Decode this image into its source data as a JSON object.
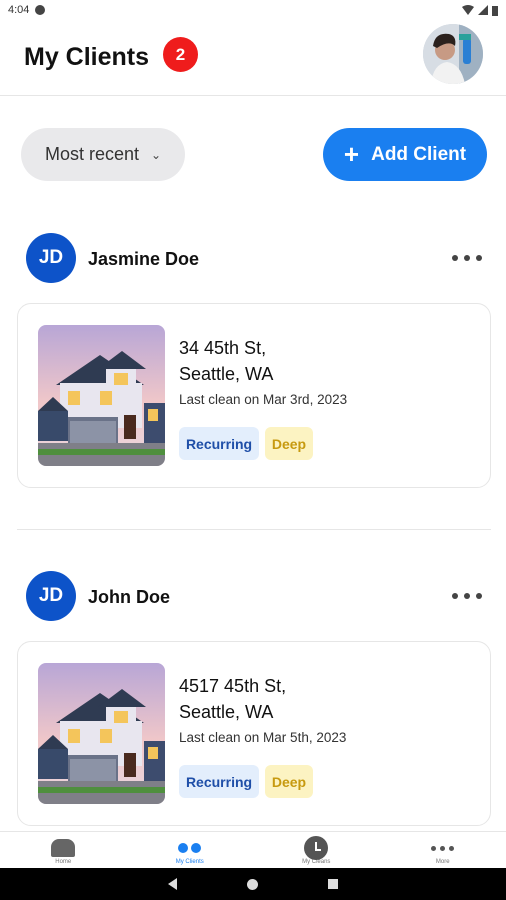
{
  "status_bar": {
    "time": "4:04"
  },
  "header": {
    "title": "My Clients",
    "badge_count": "2"
  },
  "toolbar": {
    "sort_label": "Most recent",
    "add_client_label": "Add Client"
  },
  "clients": [
    {
      "initials": "JD",
      "name": "Jasmine Doe",
      "address_line1": "34 45th St,",
      "address_line2": "Seattle, WA",
      "last_clean": "Last clean on Mar 3rd, 2023",
      "tags": [
        "Recurring",
        "Deep"
      ]
    },
    {
      "initials": "JD",
      "name": "John Doe",
      "address_line1": "4517 45th St,",
      "address_line2": "Seattle, WA",
      "last_clean": "Last clean on Mar 5th, 2023",
      "tags": [
        "Recurring",
        "Deep"
      ]
    }
  ],
  "bottom_nav": {
    "items": [
      {
        "label": "Home",
        "icon": "home-icon"
      },
      {
        "label": "My Clients",
        "icon": "clients-icon",
        "active": true
      },
      {
        "label": "My Cleans",
        "icon": "clock-icon"
      },
      {
        "label": "More",
        "icon": "more-icon"
      }
    ]
  },
  "colors": {
    "accent": "#1a7ff0",
    "badge": "#ef1c1c",
    "avatar": "#0d53c9",
    "tag_recurring_bg": "#e3eefc",
    "tag_deep_bg": "#fcf3c2"
  }
}
